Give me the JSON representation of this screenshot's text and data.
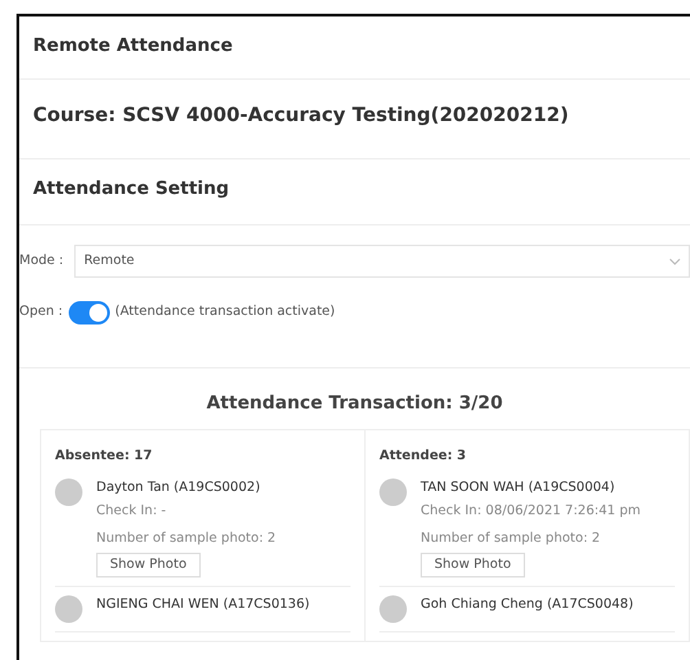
{
  "page_title": "Remote Attendance",
  "course": "Course: SCSV 4000-Accuracy Testing(202020212)",
  "setting_title": "Attendance Setting",
  "mode": {
    "label": "Mode :",
    "value": "Remote"
  },
  "open": {
    "label": "Open :",
    "on": true,
    "note": "(Attendance transaction activate)"
  },
  "transaction_title": "Attendance Transaction: 3/20",
  "groups": [
    {
      "title": "Absentee: 17",
      "students": [
        {
          "name": "Dayton Tan (A19CS0002)",
          "check_in": "Check In: -",
          "photos": "Number of sample photo: 2",
          "button": "Show Photo"
        },
        {
          "name": "NGIENG CHAI WEN (A17CS0136)"
        }
      ]
    },
    {
      "title": "Attendee: 3",
      "students": [
        {
          "name": "TAN SOON WAH (A19CS0004)",
          "check_in": "Check In: 08/06/2021 7:26:41 pm",
          "photos": "Number of sample photo: 2",
          "button": "Show Photo"
        },
        {
          "name": "Goh Chiang Cheng (A17CS0048)"
        }
      ]
    }
  ]
}
